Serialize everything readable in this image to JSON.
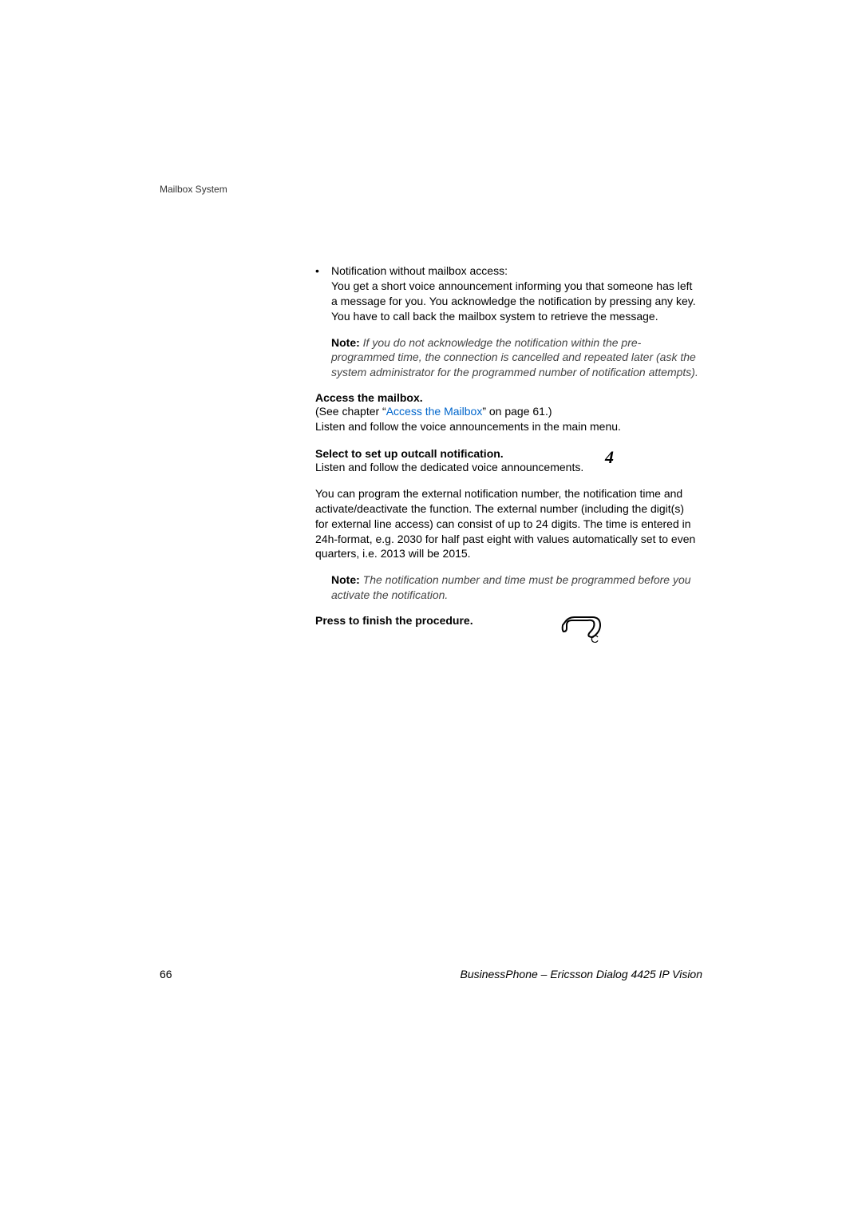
{
  "header": {
    "section": "Mailbox System"
  },
  "bullet": {
    "marker": "•",
    "title": "Notification without mailbox access:",
    "body": "You get a short voice announcement informing you that someone has left a message for you. You acknowledge the notification by pressing any key. You have to call back the mailbox system to retrieve the message."
  },
  "note1": {
    "label": "Note:",
    "text": " If you do not acknowledge the notification within the pre-programmed time, the connection is cancelled and repeated later (ask the system administrator for the programmed number of notification attempts)."
  },
  "access": {
    "heading": "Access the mailbox.",
    "line_prefix": "(See chapter “",
    "link": "Access the Mailbox",
    "line_suffix": "” on page 61.)",
    "line2": "Listen and follow the voice announcements in the main menu."
  },
  "step4": {
    "number": "4",
    "heading": "Select to set up outcall notification.",
    "body": "Listen and follow the dedicated voice announcements.",
    "para": "You can program the external notification number, the notification time and activate/deactivate the function. The external number (including the digit(s) for external line access) can consist of up to 24 digits. The time is entered in 24h-format, e.g. 2030 for half past eight with values automatically set to even quarters, i.e. 2013 will be 2015."
  },
  "note2": {
    "label": "Note:",
    "text": " The notification number and time must be programmed before you activate the notification."
  },
  "finish": {
    "icon_label": "C",
    "heading": "Press to finish the procedure."
  },
  "footer": {
    "page": "66",
    "title": "BusinessPhone – Ericsson Dialog 4425 IP Vision"
  }
}
